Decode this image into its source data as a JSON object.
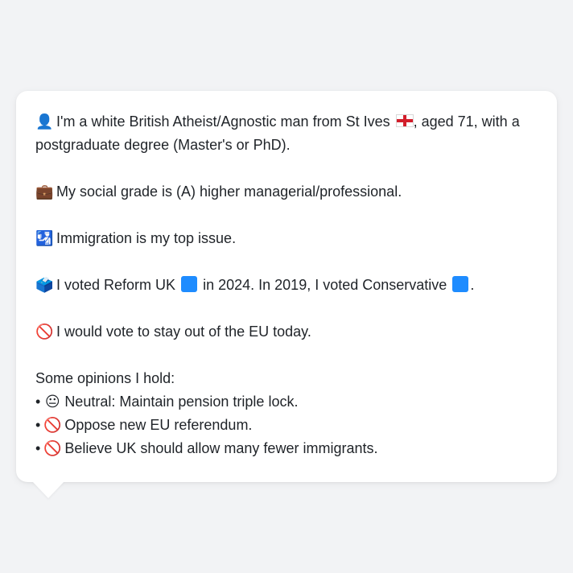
{
  "colors": {
    "background": "#f2f3f5",
    "bubble": "#ffffff",
    "text": "#1f2328",
    "reform": "#1e8cff",
    "conservative": "#1e8cff"
  },
  "profile": {
    "intro": {
      "icon": "👤",
      "text_before_flag": "I'm a white British Atheist/Agnostic man from St Ives",
      "flag_icon": "england-flag-icon",
      "text_after_flag": ", aged 71, with a postgraduate degree (Master's or PhD)."
    },
    "social": {
      "icon": "💼",
      "text": "My social grade is (A) higher managerial/professional."
    },
    "issue": {
      "icon": "🛂",
      "text": "Immigration is my top issue."
    },
    "vote": {
      "icon": "🗳️",
      "text_part1": "I voted Reform UK",
      "text_part2": "in 2024. In 2019, I voted Conservative",
      "text_part3": "."
    },
    "eu": {
      "icon": "🚫",
      "text": "I would vote to stay out of the EU today."
    },
    "opinions_heading": "Some opinions I hold:",
    "opinions": [
      {
        "bullet": "•",
        "icon": "😐",
        "text": "Neutral: Maintain pension triple lock."
      },
      {
        "bullet": "•",
        "icon": "🚫",
        "text": "Oppose new EU referendum."
      },
      {
        "bullet": "•",
        "icon": "🚫",
        "text": "Believe UK should allow many fewer immigrants."
      }
    ]
  }
}
